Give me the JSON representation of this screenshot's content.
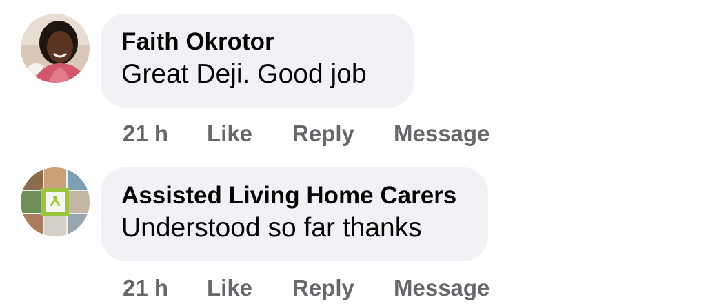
{
  "comments": [
    {
      "author": "Faith Okrotor",
      "text": "Great Deji. Good job",
      "time": "21 h",
      "actions": {
        "like": "Like",
        "reply": "Reply",
        "message": "Message"
      }
    },
    {
      "author": "Assisted Living Home Carers",
      "text": "Understood so far thanks",
      "time": "21 h",
      "actions": {
        "like": "Like",
        "reply": "Reply",
        "message": "Message"
      }
    }
  ]
}
